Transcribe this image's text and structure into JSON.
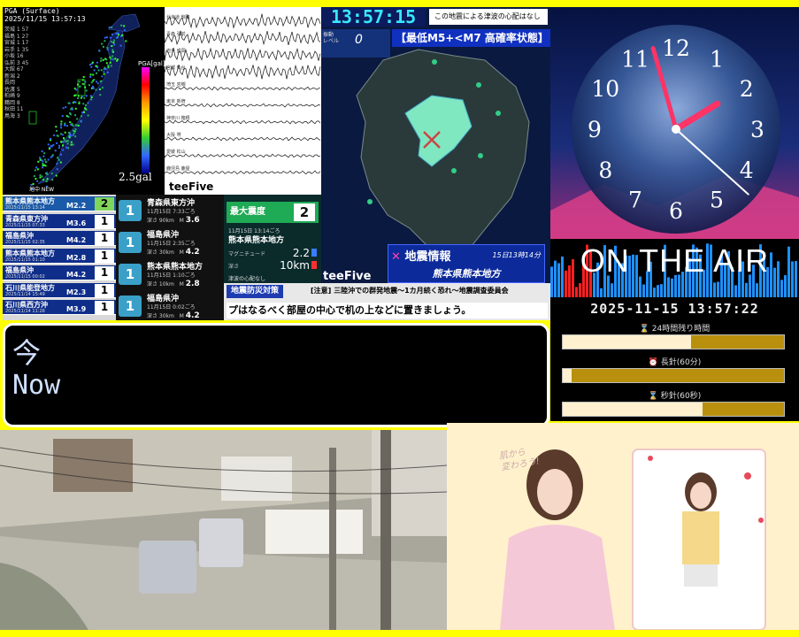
{
  "seismic_map": {
    "header_lines": [
      "PGA (Surface)",
      "2025/11/15 13:57:13"
    ],
    "mini_list": [
      "茨城 1 57",
      "福島 1 27",
      "宮城 1 17",
      "岩手 1 35",
      "小坂 16",
      "弘前 3 45",
      "大館 67",
      "新潟 2",
      "長岡",
      "佐渡 5",
      "柏崎 9",
      "鶴岡 8",
      "秋田 11",
      "鳥海 3"
    ],
    "pga_label": "PGA[gal]",
    "gal_label": "2.5gal"
  },
  "waveform": {
    "station_labels": [
      "北海道 釧路",
      "青森 弘前",
      "岩手 盛岡",
      "宮城 仙台",
      "埼玉 岩槻",
      "東京 新宿",
      "神奈川 箱根",
      "大阪 堺",
      "愛媛 松山",
      "鹿児島 鹿屋"
    ],
    "brand": "teeFive"
  },
  "kumamoto_map": {
    "time": "13:57:15",
    "tsunami_note": "この地震による津波の心配はなし",
    "level_label_1": "振動",
    "level_label_2": "レベル",
    "level_value": "0",
    "warning_banner": "【最低M5+<M7 高確率状態】",
    "brand": "teeFive",
    "info_title": "地震情報",
    "info_time": "15日13時14分",
    "info_region": "熊本県熊本地方"
  },
  "quake_list": {
    "news_label": "地中 NEW",
    "items": [
      {
        "name": "熊本県熊本地方",
        "date": "2025/11/15 13:14",
        "mag": "M2.2",
        "intensity": "2"
      },
      {
        "name": "青森県東方沖",
        "date": "2025/11/15 07:33",
        "mag": "M3.6",
        "intensity": "1"
      },
      {
        "name": "福島県沖",
        "date": "2025/11/15 02:35",
        "mag": "M4.2",
        "intensity": "1"
      },
      {
        "name": "熊本県熊本地方",
        "date": "2025/11/15 01:10",
        "mag": "M2.8",
        "intensity": "1"
      },
      {
        "name": "福島県沖",
        "date": "2025/11/15 00:02",
        "mag": "M4.2",
        "intensity": "1"
      },
      {
        "name": "石川県能登地方",
        "date": "2025/11/14 15:49",
        "mag": "M2.3",
        "intensity": "1"
      },
      {
        "name": "石川県西方沖",
        "date": "2025/11/14 11:26",
        "mag": "M3.9",
        "intensity": "1"
      }
    ]
  },
  "quake_detail": {
    "items": [
      {
        "intensity": "1",
        "name": "青森県東方沖",
        "date": "11月15日 7:33ごろ",
        "depth": "深さ 90km",
        "mag": "3.6"
      },
      {
        "intensity": "1",
        "name": "福島県沖",
        "date": "11月15日 2:35ごろ",
        "depth": "深さ 30km",
        "mag": "4.2"
      },
      {
        "intensity": "1",
        "name": "熊本県熊本地方",
        "date": "11月15日 1:10ごろ",
        "depth": "深さ 10km",
        "mag": "2.8"
      },
      {
        "intensity": "1",
        "name": "福島県沖",
        "date": "11月15日 0:02ごろ",
        "depth": "深さ 30km",
        "mag": "4.2"
      }
    ]
  },
  "max_intensity": {
    "label": "最大震度",
    "value": "2",
    "time": "11月15日 13:14ごろ",
    "region": "熊本県熊本地方",
    "mag_label": "マグニチュード",
    "mag_value": "2.2",
    "depth_label": "深さ",
    "depth_value": "10km",
    "tsunami": "津波の心配なし"
  },
  "ticker": {
    "tag": "地震防災対策",
    "headline": "[注意] 三陸沖での群発地震～1カ月続く恐れ～地震調査委員会",
    "message": "プはなるべく部屋の中心で机の上などに置きましょう。"
  },
  "clock": {
    "numerals": [
      "12",
      "1",
      "2",
      "3",
      "4",
      "5",
      "6",
      "7",
      "8",
      "9",
      "10",
      "11"
    ],
    "hour": 13,
    "minute": 57,
    "second": 22
  },
  "on_air": "ON THE AIR",
  "progress": {
    "datetime": "2025-11-15 13:57:22",
    "bars": [
      {
        "label": "⌛ 24時間残り時間",
        "fraction": 0.58
      },
      {
        "label": "⏰ 長針(60分)",
        "fraction": 0.04
      },
      {
        "label": "⌛ 秒針(60秒)",
        "fraction": 0.63
      }
    ]
  },
  "now_box": {
    "line1": "今",
    "line2": "Now"
  },
  "ad": {
    "copy": "肌から\n変わろう!"
  },
  "colors": {
    "frame": "#ffff00",
    "accent_cyan": "#38e8ff",
    "onair_bars": "#1e90ff"
  }
}
